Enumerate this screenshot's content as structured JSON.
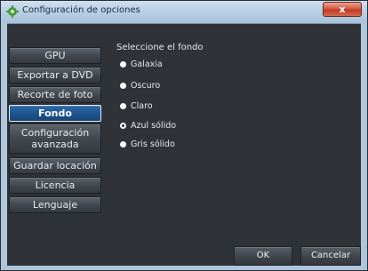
{
  "window": {
    "title": "Configuración de opciones",
    "close_label": "x"
  },
  "sidebar": {
    "items": [
      {
        "label": "GPU"
      },
      {
        "label": "Exportar a DVD"
      },
      {
        "label": "Recorte de foto"
      },
      {
        "label": "Fondo",
        "active": true
      },
      {
        "label": "Configuración avanzada",
        "line1": "Configuración",
        "line2": "avanzada"
      },
      {
        "label": "Guardar locación"
      },
      {
        "label": "Licencia"
      },
      {
        "label": "Lenguaje"
      }
    ]
  },
  "background": {
    "heading": "Seleccione el fondo",
    "options": [
      {
        "label": "Galaxia",
        "selected": false
      },
      {
        "label": "Oscuro",
        "selected": false
      },
      {
        "label": "Claro",
        "selected": false
      },
      {
        "label": "Azul sólido",
        "selected": true
      },
      {
        "label": "Gris sólido",
        "selected": false
      }
    ]
  },
  "footer": {
    "ok_label": "OK",
    "cancel_label": "Cancelar"
  },
  "colors": {
    "accent": "#1e5590",
    "panel": "#2f3338",
    "titlebar": "#b9cfe3",
    "close": "#c23b22"
  }
}
